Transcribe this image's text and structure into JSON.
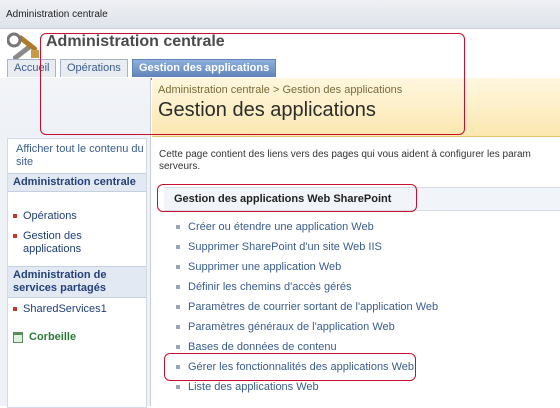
{
  "window": {
    "title": "Administration centrale"
  },
  "header": {
    "site_title": "Administration centrale",
    "tabs": [
      {
        "label": "Accueil",
        "active": false
      },
      {
        "label": "Opérations",
        "active": false
      },
      {
        "label": "Gestion des applications",
        "active": true
      }
    ]
  },
  "banner": {
    "breadcrumb_root": "Administration centrale",
    "breadcrumb_sep": ">",
    "breadcrumb_current": "Gestion des applications",
    "title": "Gestion des applications"
  },
  "leftnav": {
    "view_all": "Afficher tout le contenu du site",
    "sections": [
      {
        "heading": "Administration centrale",
        "items": [
          "Opérations",
          "Gestion des applications"
        ]
      },
      {
        "heading": "Administration de services partagés",
        "items": [
          "SharedServices1"
        ]
      }
    ],
    "recycle": "Corbeille"
  },
  "main": {
    "description": "Cette page contient des liens vers des pages qui vous aident à configurer les param serveurs.",
    "section_title": "Gestion des applications Web SharePoint",
    "links": [
      "Créer ou étendre une application Web",
      "Supprimer SharePoint d'un site Web IIS",
      "Supprimer une application Web",
      "Définir les chemins d'accès gérés",
      "Paramètres de courrier sortant de l'application Web",
      "Paramètres généraux de l'application Web",
      "Bases de données de contenu",
      "Gérer les fonctionnalités des applications Web",
      "Liste des applications Web"
    ]
  },
  "colors": {
    "accent": "#5f83b9",
    "highlight": "#c8102e",
    "banner": "#fbe7b0"
  }
}
